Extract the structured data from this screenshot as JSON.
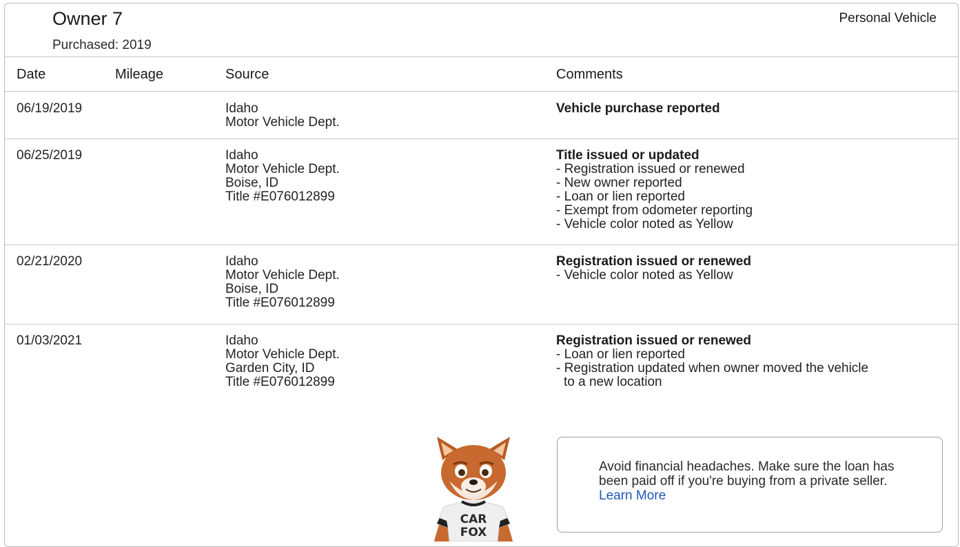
{
  "owner": {
    "title": "Owner 7",
    "purchased": "Purchased: 2019",
    "vehicle_type": "Personal Vehicle"
  },
  "table": {
    "headers": [
      "Date",
      "Mileage",
      "Source",
      "Comments"
    ],
    "rows": [
      {
        "date": "06/19/2019",
        "mileage": "",
        "source": [
          "Idaho",
          "Motor Vehicle Dept."
        ],
        "comment_title": "Vehicle purchase reported",
        "comment_items": []
      },
      {
        "date": "06/25/2019",
        "mileage": "",
        "source": [
          "Idaho",
          "Motor Vehicle Dept.",
          "Boise, ID",
          "Title #E076012899"
        ],
        "comment_title": "Title issued or updated",
        "comment_items": [
          "- Registration issued or renewed",
          "- New owner reported",
          "- Loan or lien reported",
          "- Exempt from odometer reporting",
          "- Vehicle color noted as Yellow"
        ]
      },
      {
        "date": "02/21/2020",
        "mileage": "",
        "source": [
          "Idaho",
          "Motor Vehicle Dept.",
          "Boise, ID",
          "Title #E076012899"
        ],
        "comment_title": "Registration issued or renewed",
        "comment_items": [
          "- Vehicle color noted as Yellow"
        ]
      },
      {
        "date": "01/03/2021",
        "mileage": "",
        "source": [
          "Idaho",
          "Motor Vehicle Dept.",
          "Garden City, ID",
          "Title #E076012899"
        ],
        "comment_title": "Registration issued or renewed",
        "comment_items": [
          "- Loan or lien reported",
          "- Registration updated when owner moved the vehicle",
          "to a new location"
        ]
      }
    ]
  },
  "mascot": {
    "shirt_line1": "CAR",
    "shirt_line2": "FOX"
  },
  "promo": {
    "text": "Avoid financial headaches. Make sure the loan has been paid off if you're buying from a private seller.",
    "link_label": "Learn More"
  },
  "colors": {
    "link": "#1f58b8",
    "border": "#c4c4c4",
    "fox_fur": "#c8692f"
  }
}
